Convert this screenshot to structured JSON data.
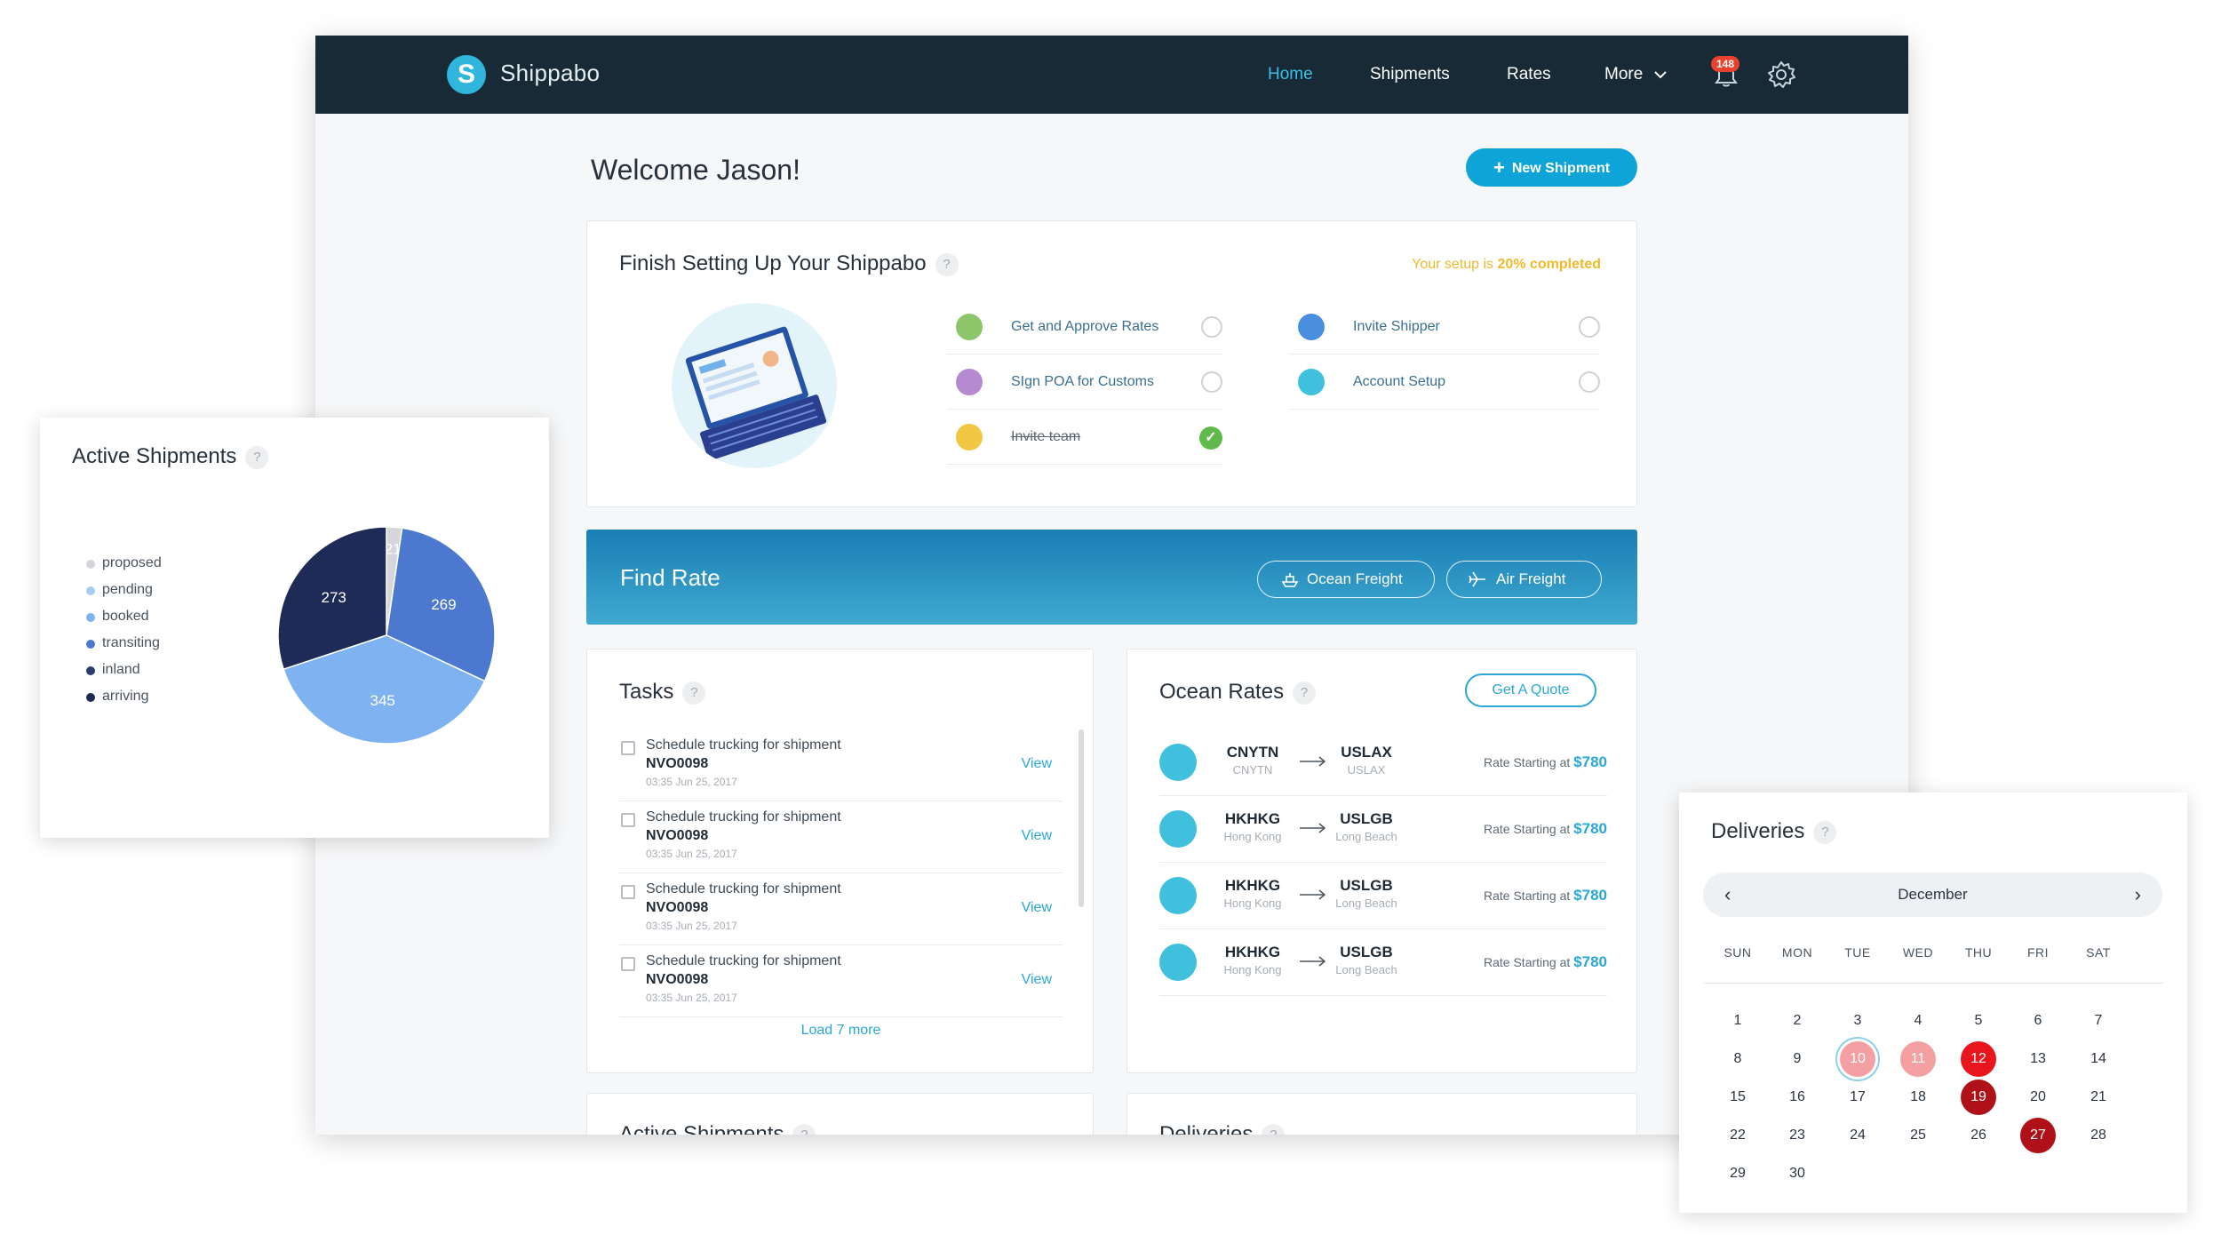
{
  "app": {
    "brand": "Shippabo",
    "logo_letter": "S",
    "nav": [
      "Home",
      "Shipments",
      "Rates",
      "More"
    ],
    "notification_count": "148"
  },
  "welcome": "Welcome Jason!",
  "new_shipment": "New Shipment",
  "setup": {
    "title": "Finish Setting Up Your Shippabo",
    "help": "?",
    "progress_prefix": "Your setup is",
    "progress_value": "20% completed",
    "items": [
      {
        "label": "Get and Approve Rates",
        "done": false,
        "icon_color": "#8cc56a"
      },
      {
        "label": "SIgn POA for Customs",
        "done": false,
        "icon_color": "#b58ad1"
      },
      {
        "label": "Invite team",
        "done": true,
        "icon_color": "#f2c744"
      },
      {
        "label": "Invite Shipper",
        "done": false,
        "icon_color": "#4a8fde"
      },
      {
        "label": "Account Setup",
        "done": false,
        "icon_color": "#3fc0dd"
      }
    ]
  },
  "find_rate": {
    "title": "Find Rate",
    "ocean": "Ocean Freight",
    "air": "Air Freight"
  },
  "tasks": {
    "title": "Tasks",
    "items": [
      {
        "text": "Schedule trucking for shipment",
        "id": "NVO0098",
        "time": "03:35 Jun 25, 2017",
        "action": "View"
      },
      {
        "text": "Schedule trucking for shipment",
        "id": "NVO0098",
        "time": "03:35 Jun 25, 2017",
        "action": "View"
      },
      {
        "text": "Schedule trucking for shipment",
        "id": "NVO0098",
        "time": "03:35 Jun 25, 2017",
        "action": "View"
      },
      {
        "text": "Schedule trucking for shipment",
        "id": "NVO0098",
        "time": "03:35 Jun 25, 2017",
        "action": "View"
      }
    ],
    "load_more": "Load 7 more"
  },
  "ocean_rates": {
    "title": "Ocean Rates",
    "quote": "Get A Quote",
    "price_prefix": "Rate Starting at",
    "rows": [
      {
        "from": "CNYTN",
        "from_city": "CNYTN",
        "to": "USLAX",
        "to_city": "USLAX",
        "price": "$780"
      },
      {
        "from": "HKHKG",
        "from_city": "Hong Kong",
        "to": "USLGB",
        "to_city": "Long Beach",
        "price": "$780"
      },
      {
        "from": "HKHKG",
        "from_city": "Hong Kong",
        "to": "USLGB",
        "to_city": "Long Beach",
        "price": "$780"
      },
      {
        "from": "HKHKG",
        "from_city": "Hong Kong",
        "to": "USLGB",
        "to_city": "Long Beach",
        "price": "$780"
      }
    ]
  },
  "peek": {
    "active": "Active Shipments",
    "deliveries": "Deliveries"
  },
  "active_shipments": {
    "title": "Active Shipments",
    "legend": [
      {
        "label": "proposed",
        "color": "#d4d6d9"
      },
      {
        "label": "pending",
        "color": "#a9cdf2"
      },
      {
        "label": "booked",
        "color": "#7fb2f0"
      },
      {
        "label": "transiting",
        "color": "#4c79cf"
      },
      {
        "label": "inland",
        "color": "#2c3d70"
      },
      {
        "label": "arriving",
        "color": "#1e2b57"
      }
    ]
  },
  "chart_data": {
    "type": "pie",
    "title": "Active Shipments",
    "slices": [
      {
        "label": "proposed",
        "value": 21,
        "color": "#d4d6d9",
        "show_label": "21"
      },
      {
        "label": "transiting",
        "value": 269,
        "color": "#4c79cf",
        "show_label": "269"
      },
      {
        "label": "booked",
        "value": 345,
        "color": "#7fb2f0",
        "show_label": "345"
      },
      {
        "label": "arriving",
        "value": 273,
        "color": "#1e2b57",
        "show_label": "273"
      }
    ],
    "legend_placement": "left"
  },
  "deliveries": {
    "title": "Deliveries",
    "month": "December",
    "weekdays": [
      "SUN",
      "MON",
      "TUE",
      "WED",
      "THU",
      "FRI",
      "SAT"
    ],
    "weeks": [
      [
        "1",
        "2",
        "3",
        "4",
        "5",
        "6",
        "7"
      ],
      [
        "8",
        "9",
        "10",
        "11",
        "12",
        "13",
        "14"
      ],
      [
        "15",
        "16",
        "17",
        "18",
        "19",
        "20",
        "21"
      ],
      [
        "22",
        "23",
        "24",
        "25",
        "26",
        "27",
        "28"
      ],
      [
        "29",
        "30",
        "",
        "",
        "",
        "",
        ""
      ]
    ],
    "highlights": {
      "10": {
        "bg": "#f4a0a3",
        "color": "#ffffff",
        "ring": true
      },
      "11": {
        "bg": "#f4a0a3",
        "color": "#ffffff",
        "ring": false
      },
      "12": {
        "bg": "#e8161c",
        "color": "#ffffff",
        "ring": false
      },
      "19": {
        "bg": "#b01018",
        "color": "#ffffff",
        "ring": false
      },
      "27": {
        "bg": "#b01018",
        "color": "#ffffff",
        "ring": false
      }
    }
  }
}
